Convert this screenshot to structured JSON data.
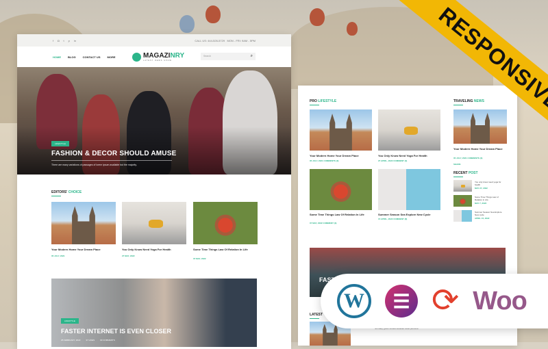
{
  "topbar": {
    "social_icons": [
      "facebook-icon",
      "instagram-icon",
      "twitter-icon",
      "pinterest-icon",
      "linkedin-icon"
    ],
    "contact": "CALL US: 444-526-5729",
    "hours": "MON - FRI: 9AM - 5PM"
  },
  "nav": {
    "items": [
      "HOME",
      "BLOG",
      "CONTACT US",
      "MORE"
    ],
    "logo_main": "MAGAZI",
    "logo_accent": "NRY",
    "logo_tagline": "LATEST NEWS SHOW",
    "search_placeholder": "Search"
  },
  "hero": {
    "tag": "LIFESTYLE",
    "title": "FASHION & DECOR SHOULD AMUSE",
    "text": "There are many variations of passages of lorem ipsum available but the majority."
  },
  "editors": {
    "title": "EDITORS'",
    "accent": "CHOICE",
    "posts": [
      {
        "title": "Your Modern Home Your Dream Place",
        "date": "05 JULY, 2021"
      },
      {
        "title": "You Only Know Need Yoga For Health",
        "date": "27 MAY, 2022"
      },
      {
        "title": "Some Time Things Law Of Relation In Life",
        "date": "07 MAY, 2022"
      }
    ]
  },
  "feature": {
    "tag": "LIFESTYLE",
    "title": "FASTER INTERNET IS EVEN CLOSER",
    "date": "25 FEBRUARY, 2022",
    "likes": "37 LIKES",
    "comments": "03 COMMENTS"
  },
  "pro": {
    "title": "PRO",
    "accent": "LIFESTYLE",
    "posts": [
      {
        "title": "Your Modern Home Your Dream Place",
        "meta": "05 JULY, 2021   COMMENTS (3)"
      },
      {
        "title": "You Only Know Need Yoga For Health",
        "meta": "27 APRIL, 2022   COMMENT (3)"
      },
      {
        "title": "Some Time Things Law Of Relation In Life",
        "meta": "07 MAY, 2022   COMMENT (3)"
      },
      {
        "title": "Summer Season Sea Explore New Cycle",
        "meta": "15 APRIL, 2022   COMMENT (8)"
      }
    ]
  },
  "traveling": {
    "title": "TRAVELING",
    "accent": "NEWS",
    "post_title": "Your Modern Home Your Dream Place",
    "meta": "05 JULY, 2021   COMMENTS (3)",
    "share": "SHARE"
  },
  "recent": {
    "title": "RECENT",
    "accent": "POST",
    "posts": [
      {
        "title": "You only know need yoga for health",
        "date": "MAY 27, 2022"
      },
      {
        "title": "Some Time Things Law of Relation in Life",
        "date": "MAY 7, 2022"
      },
      {
        "title": "Summer Season Sea Explore New cycle",
        "date": "APRIL 15, 2022"
      }
    ]
  },
  "latest": {
    "title": "LATEST",
    "text": "Normally, good-minded because these personal",
    "meta": "05 JULY, 2021 - COMMENTS (3)"
  },
  "second_feature": {
    "title": "FAST"
  },
  "ribbon": "RESPONSIVE",
  "badges": [
    "wordpress-icon",
    "elementor-icon",
    "updates-icon",
    "woocommerce-icon"
  ],
  "woo_label": "Woo",
  "colors": {
    "accent": "#2bb58a",
    "ribbon": "#f2b705",
    "wordpress": "#21759b",
    "woo": "#96588a",
    "sync": "#e2402d"
  }
}
